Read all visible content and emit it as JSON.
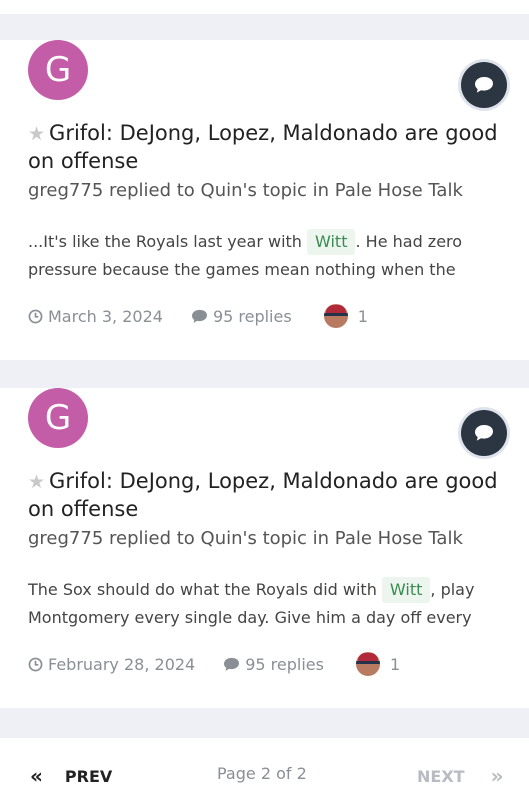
{
  "results": [
    {
      "avatar_letter": "G",
      "title": "Grifol: DeJong, Lopez, Maldonado are good on offense",
      "byline": "greg775 replied to Quin's topic in Pale Hose Talk",
      "snippet_before": "...It's like the Royals last year with ",
      "tag": "Witt",
      "snippet_after": ". He had zero pressure because the games mean nothing when the",
      "date": "March 3, 2024",
      "replies": "95 replies",
      "reactions": "1"
    },
    {
      "avatar_letter": "G",
      "title": "Grifol: DeJong, Lopez, Maldonado are good on offense",
      "byline": "greg775 replied to Quin's topic in Pale Hose Talk",
      "snippet_before": "The Sox should do what the Royals did with ",
      "tag": "Witt",
      "snippet_after": ", play Montgomery every single day. Give him a day off every",
      "date": "February 28, 2024",
      "replies": "95 replies",
      "reactions": "1"
    }
  ],
  "pagination": {
    "prev_icon": "«",
    "prev_label": "PREV",
    "page_info": "Page 2 of 2",
    "next_label": "NEXT",
    "next_icon": "»"
  },
  "colors": {
    "avatar": "#c45da8",
    "tag_text": "#3b8b52",
    "tag_bg": "#edf5ef",
    "badge": "#2c3542"
  }
}
